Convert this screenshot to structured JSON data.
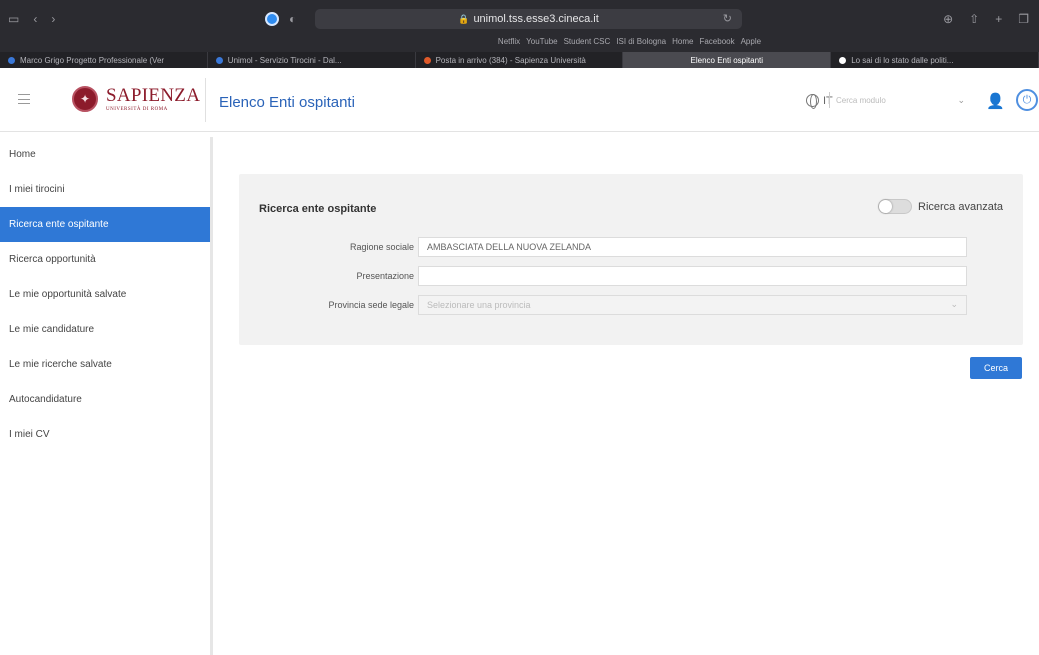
{
  "browser": {
    "address": "unimol.tss.esse3.cineca.it",
    "bookmarks": [
      "Netflix",
      "YouTube",
      "Student CSC",
      "ISI di Bologna",
      "Home",
      "Facebook",
      "Apple"
    ],
    "tabs": [
      {
        "label": "Marco Grigo Progetto Professionale (Ver",
        "color": "#3a78d8",
        "active": false
      },
      {
        "label": "Unimol - Servizio Tirocini - Dal...",
        "color": "#3a78d8",
        "active": false
      },
      {
        "label": "Posta in arrivo (384) - Sapienza Università",
        "color": "#e05a2a",
        "active": false
      },
      {
        "label": "Elenco Enti ospitanti",
        "color": "#9a9aa0",
        "active": true
      },
      {
        "label": "Lo sai di lo stato dalle politi...",
        "color": "#ffffff",
        "active": false
      }
    ]
  },
  "header": {
    "logo_main": "SAPIENZA",
    "logo_sub": "UNIVERSITÀ DI ROMA",
    "page_title": "Elenco Enti ospitanti",
    "lang": "IT",
    "search_placeholder": "Cerca modulo"
  },
  "sidebar": {
    "items": [
      {
        "label": "Home",
        "active": false
      },
      {
        "label": "I miei tirocini",
        "active": false
      },
      {
        "label": "Ricerca ente ospitante",
        "active": true
      },
      {
        "label": "Ricerca opportunità",
        "active": false
      },
      {
        "label": "Le mie opportunità salvate",
        "active": false
      },
      {
        "label": "Le mie candidature",
        "active": false
      },
      {
        "label": "Le mie ricerche salvate",
        "active": false
      },
      {
        "label": "Autocandidature",
        "active": false
      },
      {
        "label": "I miei CV",
        "active": false
      }
    ]
  },
  "search_panel": {
    "title": "Ricerca ente ospitante",
    "advanced_label": "Ricerca avanzata",
    "advanced_enabled": false,
    "fields": [
      {
        "label": "Ragione sociale",
        "value": "AMBASCIATA DELLA NUOVA ZELANDA",
        "type": "text"
      },
      {
        "label": "Presentazione",
        "value": "",
        "type": "text"
      },
      {
        "label": "Provincia sede legale",
        "value": "Selezionare una provincia",
        "type": "select"
      }
    ],
    "search_button": "Cerca"
  },
  "colors": {
    "accent": "#2f78d6",
    "brand": "#8c1b2b",
    "title": "#2a63b8"
  }
}
